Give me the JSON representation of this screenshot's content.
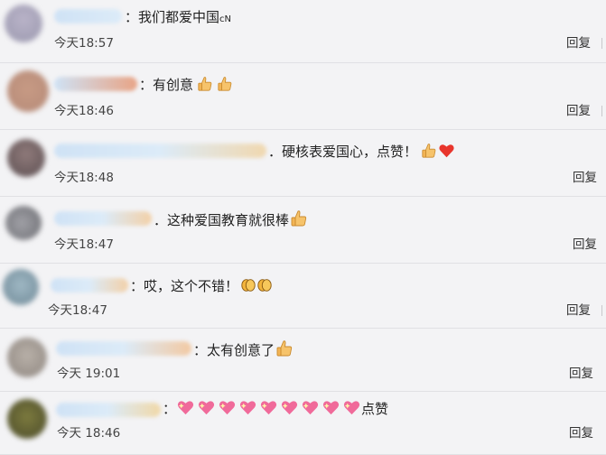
{
  "comments": [
    {
      "text": "：我们都爱中国",
      "suffix": "cN",
      "time": "今天18:57",
      "reply": "回复"
    },
    {
      "text": "：有创意",
      "time": "今天18:46",
      "reply": "回复"
    },
    {
      "text": "．硬核表爱国心，点赞！",
      "time": "今天18:48",
      "reply": "回复"
    },
    {
      "text": "．这种爱国教育就很棒",
      "time": "今天18:47",
      "reply": "回复"
    },
    {
      "text": "：哎，这个不错！",
      "time": "今天18:47",
      "reply": "回复"
    },
    {
      "text": "：太有创意了",
      "time": "今天 19:01",
      "reply": "回复"
    },
    {
      "text": "：",
      "suffix": "点赞",
      "time": "今天 18:46",
      "reply": "回复"
    }
  ],
  "icons": {
    "thumbs_up": "thumbs-up-icon",
    "red_heart": "red-heart-icon",
    "clapping": "clapping-hands-icon",
    "sparkling_heart": "sparkling-heart-icon"
  },
  "colors": {
    "background": "#f3f3f5",
    "divider": "#e0e0e4",
    "thumb": "#f6c36b",
    "heart": "#e8352c",
    "pink_heart": "#f06a9a"
  }
}
